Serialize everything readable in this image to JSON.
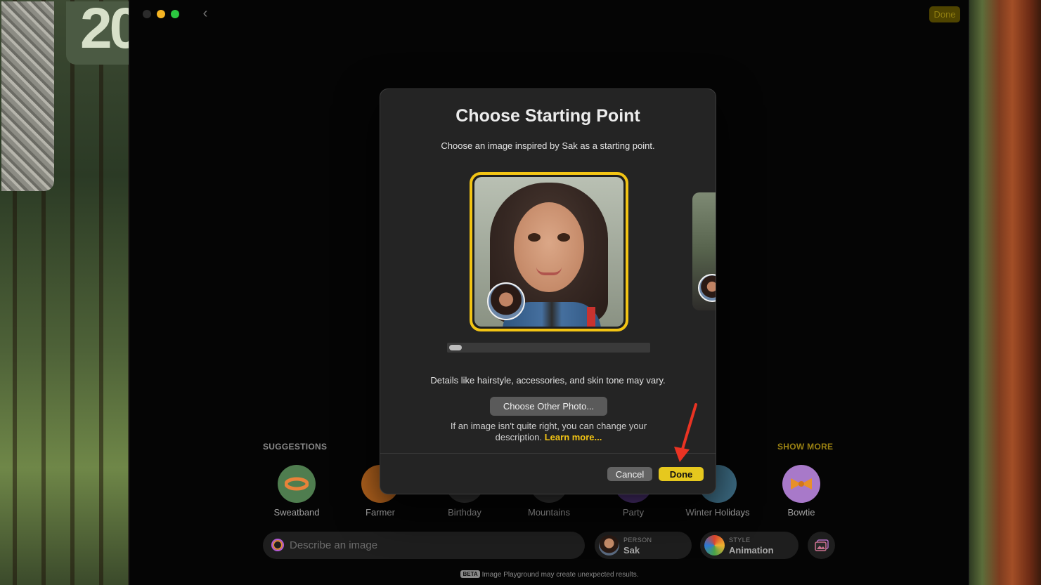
{
  "window": {
    "back_glyph": "‹",
    "top_done_label": "Done"
  },
  "wallpaper": {
    "widget_text": "20"
  },
  "modal": {
    "title": "Choose Starting Point",
    "subtitle": "Choose an image inspired by Sak as a starting point.",
    "details_text": "Details like hairstyle, accessories, and skin tone may vary.",
    "choose_other_label": "Choose Other Photo...",
    "hint_text": "If an image isn't quite right, you can change your description.",
    "learn_more_label": "Learn more...",
    "cancel_label": "Cancel",
    "done_label": "Done",
    "accent_color": "#f2c414"
  },
  "suggestions": {
    "header": "SUGGESTIONS",
    "show_more_label": "SHOW MORE",
    "items": [
      {
        "label": "Sweatband",
        "icon": "sweatband-icon",
        "color": "#4f7d4f"
      },
      {
        "label": "Farmer",
        "icon": "farmer-hat-icon",
        "color": "#b7651e"
      },
      {
        "label": "Birthday",
        "icon": "birthday-cake-icon",
        "color": "#3c3c3c"
      },
      {
        "label": "Mountains",
        "icon": "mountains-icon",
        "color": "#3a3a3a"
      },
      {
        "label": "Party",
        "icon": "party-icon",
        "color": "#5b3a8a"
      },
      {
        "label": "Winter Holidays",
        "icon": "snowman-icon",
        "color": "#3e6e86"
      },
      {
        "label": "Bowtie",
        "icon": "bowtie-icon",
        "color": "#a879c9"
      }
    ]
  },
  "bottom_bar": {
    "describe_placeholder": "Describe an image",
    "person_caption": "PERSON",
    "person_value": "Sak",
    "style_caption": "STYLE",
    "style_value": "Animation",
    "beta_badge": "BETA",
    "beta_text": "Image Playground may create unexpected results."
  }
}
